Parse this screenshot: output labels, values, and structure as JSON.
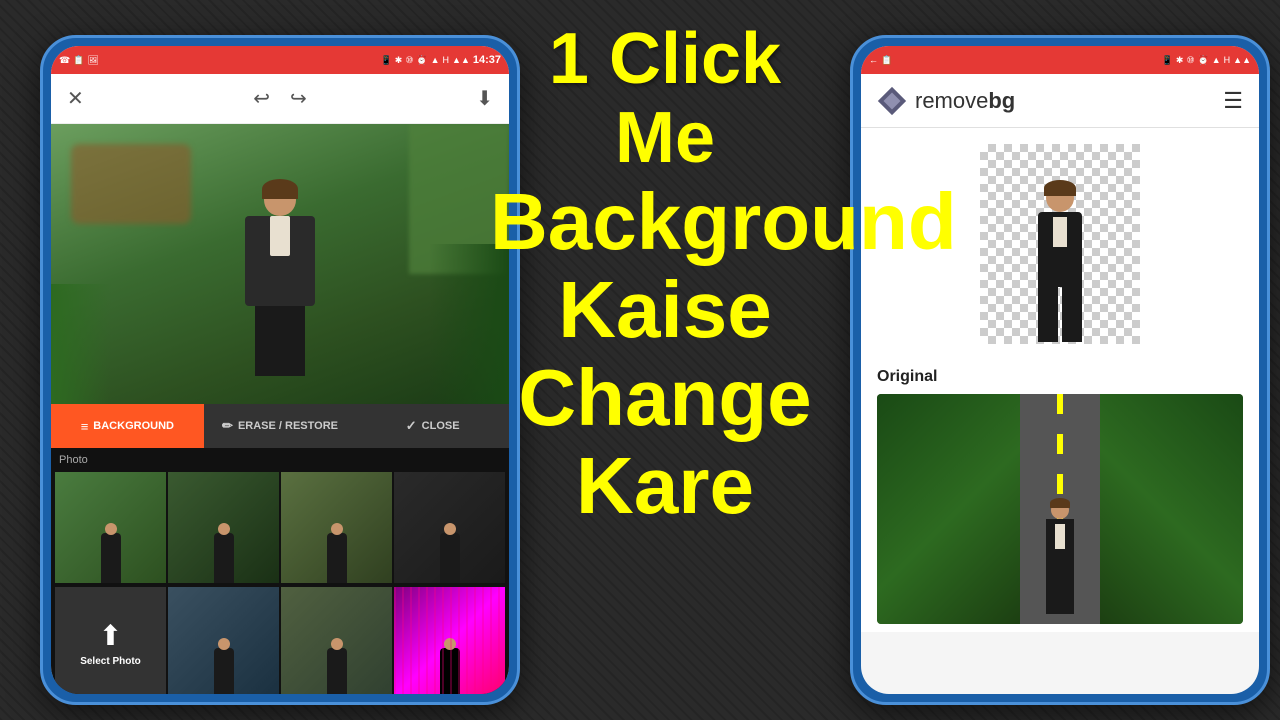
{
  "background": {
    "color": "#2a2a2a"
  },
  "center_text": {
    "line1": "1 Click",
    "line2": "Me",
    "line3": "Background",
    "line4": "Kaise",
    "line5": "Change",
    "line6": "Kare"
  },
  "left_phone": {
    "status_bar": {
      "time": "14:37",
      "icons": "☎ 📋 🖼 📱 ✱ ⑩ ⏰ ▲ H ▲ ▲"
    },
    "toolbar": {
      "close_label": "✕",
      "undo_label": "↩",
      "redo_label": "↪",
      "download_label": "⬇"
    },
    "tabs": [
      {
        "label": "BACKGROUND",
        "icon": "≡",
        "active": true
      },
      {
        "label": "ERASE / RESTORE",
        "icon": "✏",
        "active": false
      },
      {
        "label": "CLOSE",
        "icon": "✓",
        "active": false
      }
    ],
    "photo_section": {
      "label": "Photo"
    },
    "select_photo": {
      "label": "Select Photo",
      "icon": "⬆"
    }
  },
  "right_phone": {
    "status_bar": {
      "icons": "← 📋 📱 ✱ ⑩ ⏰ ▲ H ▲ ▲"
    },
    "app": {
      "name": "removebg",
      "logo_text": "remove",
      "logo_bold": "bg"
    },
    "original_label": "Original",
    "hamburger": "☰"
  }
}
